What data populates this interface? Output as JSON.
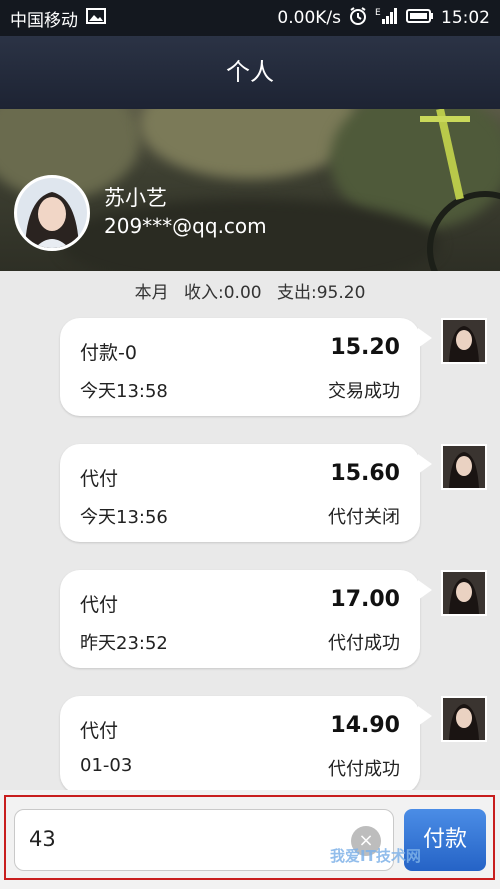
{
  "status_bar": {
    "carrier": "中国移动",
    "speed": "0.00K/s",
    "time": "15:02",
    "network_label": "E"
  },
  "header": {
    "title": "个人"
  },
  "profile": {
    "name": "苏小艺",
    "email": "209***@qq.com"
  },
  "summary": {
    "period": "本月",
    "income": "收入:0.00",
    "expense": "支出:95.20"
  },
  "transactions": [
    {
      "title": "付款-0",
      "amount": "15.20",
      "time": "今天13:58",
      "status": "交易成功"
    },
    {
      "title": "代付",
      "amount": "15.60",
      "time": "今天13:56",
      "status": "代付关闭"
    },
    {
      "title": "代付",
      "amount": "17.00",
      "time": "昨天23:52",
      "status": "代付成功"
    },
    {
      "title": "代付",
      "amount": "14.90",
      "time": "01-03",
      "status": "代付成功"
    }
  ],
  "input_bar": {
    "value": "43",
    "clear_icon": "×",
    "pay_label": "付款"
  },
  "watermark": "我爱IT技术网",
  "colors": {
    "titlebar": "#232a3b",
    "pay_button": "#3b7bd8",
    "highlight_frame": "#c81e1e"
  }
}
